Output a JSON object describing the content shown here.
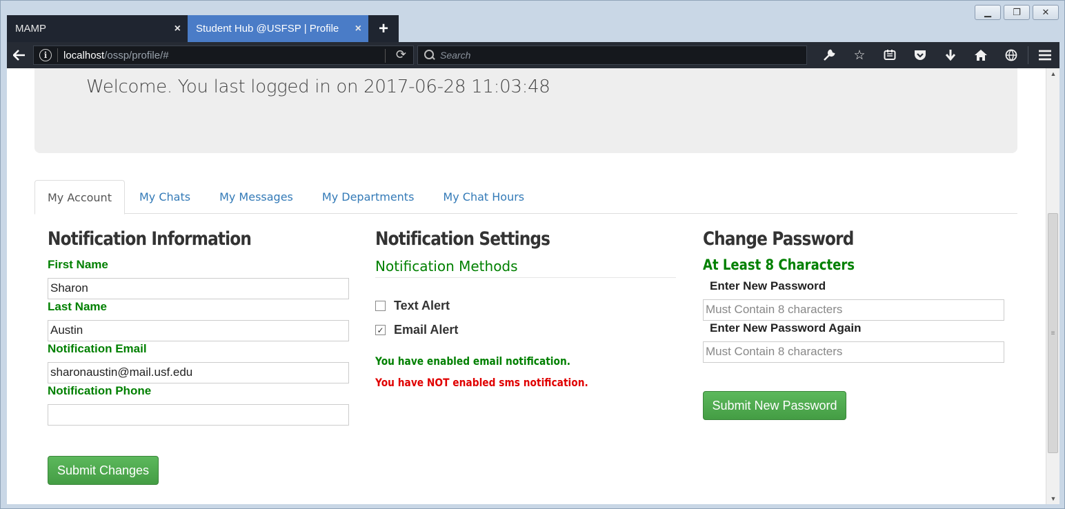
{
  "browser": {
    "tabs": [
      {
        "label": "MAMP",
        "active": false
      },
      {
        "label": "Student Hub @USFSP | Profile",
        "active": true
      }
    ],
    "new_tab_symbol": "+",
    "close_symbol": "×",
    "url_host": "localhost",
    "url_path": "/ossp/profile/#",
    "search_placeholder": "Search",
    "toolbar_icons": [
      "wrench-icon",
      "star-icon",
      "reader-icon",
      "pocket-icon",
      "download-icon",
      "home-icon",
      "globe-icon",
      "menu-icon"
    ],
    "window_controls": [
      "minimize",
      "restore",
      "close"
    ]
  },
  "page": {
    "welcome": "Welcome. You last logged in on 2017-06-28 11:03:48",
    "tabs": [
      "My Account",
      "My Chats",
      "My Messages",
      "My Departments",
      "My Chat Hours"
    ],
    "active_tab": "My Account",
    "notification_info": {
      "title": "Notification Information",
      "first_name_label": "First Name",
      "first_name_value": "Sharon",
      "last_name_label": "Last Name",
      "last_name_value": "Austin",
      "email_label": "Notification Email",
      "email_value": "sharonaustin@mail.usf.edu",
      "phone_label": "Notification Phone",
      "phone_value": "",
      "submit_label": "Submit Changes"
    },
    "notification_settings": {
      "title": "Notification Settings",
      "methods_label": "Notification Methods",
      "text_alert_label": "Text Alert",
      "text_alert_checked": false,
      "email_alert_label": "Email Alert",
      "email_alert_checked": true,
      "email_status": "You have enabled email notification.",
      "sms_status": "You have NOT enabled sms notification."
    },
    "change_password": {
      "title": "Change Password",
      "requirement": "At Least 8 Characters",
      "new_password_label": "Enter New Password",
      "new_password_placeholder": "Must Contain 8 characters",
      "confirm_password_label": "Enter New Password Again",
      "confirm_password_placeholder": "Must Contain 8 characters",
      "submit_label": "Submit New Password"
    }
  },
  "colors": {
    "label_green": "#008000",
    "error_red": "#e00000",
    "link_blue": "#337ab7",
    "button_green": "#5cb85c",
    "active_tab_blue": "#4a7cc7"
  }
}
